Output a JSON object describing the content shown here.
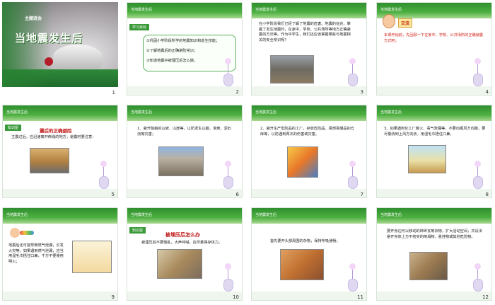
{
  "slides": [
    {
      "num": "1",
      "theme_label": "主题班会",
      "title": "当地震发生后"
    },
    {
      "num": "2",
      "header": "当地震发生后",
      "tag": "学习目标",
      "goals": [
        "①巩固小学阶段所学的地震知识和逃生技能；",
        "②了解地震后的正确避险常识；",
        "③知道地震中被埋压后怎么做。"
      ]
    },
    {
      "num": "3",
      "header": "当地震发生后",
      "text": "在小学阶段我们已经了解了地震的危害。地震的征兆，掌握了发生地震时，在家中、学校、公共场所等地方正确避震的方法等。作为中学生，我们还应该掌握哪些与地震相关的安全常识呢？"
    },
    {
      "num": "4",
      "header": "当地震发生后",
      "badge": "交流",
      "text": "本课开始前，先回顾一下在家中、学校、公共场所的正确避震方式吧。"
    },
    {
      "num": "5",
      "header": "当地震发生后",
      "tag": "知识屋",
      "title": "震后的正确避险",
      "text": "主震过后，应迅速离开倒塌的地方，避震时要注意："
    },
    {
      "num": "6",
      "header": "当地震发生后",
      "text": "1、避开陡峭的山坡、山崖等，以防发生山崩、滑坡、泥石流等灾害；"
    },
    {
      "num": "7",
      "header": "当地震发生后",
      "text": "2、避开生产危险品的工厂，存放危险品、易燃易爆品的仓库等，以防遇到再次的伤害或灾害。"
    },
    {
      "num": "8",
      "header": "当地震发生后",
      "text": "3、如果遇到化工厂着火、毒气泄漏等，不要向顺风方向跑，要尽量绕到上风方向去，用湿毛巾捂住口鼻。"
    },
    {
      "num": "9",
      "header": "当地震发生后",
      "text": "地震后还可能导致燃气泄漏，引发火灾等。如果遇到燃气泄漏，应当用湿毛巾捂住口鼻，千万不要使用明火；"
    },
    {
      "num": "10",
      "header": "当地震发生后",
      "tag": "知识屋",
      "title": "被埋压后怎么办",
      "text": "被埋压后不要慌乱，大声呼喊，应尽量保存体力。"
    },
    {
      "num": "11",
      "header": "当地震发生后",
      "text": "首先要开头部周围的杂物，保持呼吸通畅；"
    },
    {
      "num": "12",
      "header": "当地震发生后",
      "text": "要开身边可以移动的碎砖瓦等杂物，扩大活动空间，并设法避开身体上方不结实的倒塌物、悬挂物或其他危险物。"
    }
  ]
}
